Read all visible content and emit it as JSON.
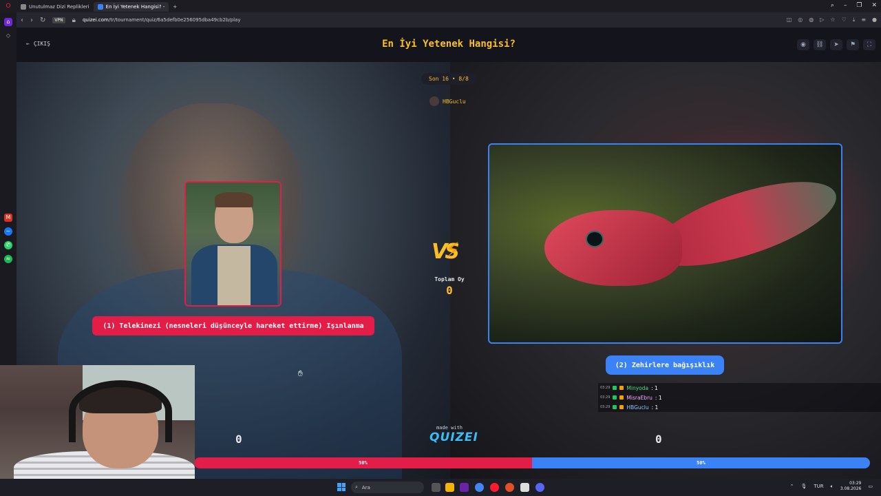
{
  "browser": {
    "tabs": [
      {
        "label": "Unutulmaz Dizi Replikleri"
      },
      {
        "label": "En İyi Yetenek Hangisi? -"
      }
    ],
    "vpn": "VPN",
    "url_domain": "quizei.com",
    "url_path": "/tr/tournament/quiz/6a5defb0e256095dba49cb2b/play"
  },
  "header": {
    "back_label": "ÇIKIŞ",
    "title": "En İyi Yetenek Hangisi?"
  },
  "round": "Son 16 • 8/8",
  "creator": "HBGuclu",
  "options": {
    "left_label": "(1) Telekinezi (nesneleri düşünceyle hareket ettirme) Işınlanma",
    "right_label": "(2) Zehirlere bağışıklık"
  },
  "vs_text": "VS",
  "total": {
    "label": "Toplam Oy",
    "value": "0"
  },
  "chat": [
    {
      "ts": "03:29",
      "user": "Minyoda",
      "text": ": 1",
      "color": "#4ade80"
    },
    {
      "ts": "03:29",
      "user": "MisraEbru",
      "text": ": 1",
      "color": "#f0abfc"
    },
    {
      "ts": "03:29",
      "user": "HBGuclu",
      "text": ": 1",
      "color": "#93c5fd"
    }
  ],
  "scores": {
    "left": "0",
    "right": "0"
  },
  "made_with": {
    "small": "made with",
    "brand": "QUIZEI"
  },
  "progress": {
    "left_pct": 50,
    "right_pct": 50,
    "left_label": "50%",
    "right_label": "50%"
  },
  "taskbar": {
    "search_placeholder": "Ara",
    "lang": "TUR",
    "time": "03:29",
    "date": "3.08.2026"
  },
  "colors": {
    "left": "#e11d48",
    "right": "#3b82f6",
    "accent": "#fbbf24"
  }
}
